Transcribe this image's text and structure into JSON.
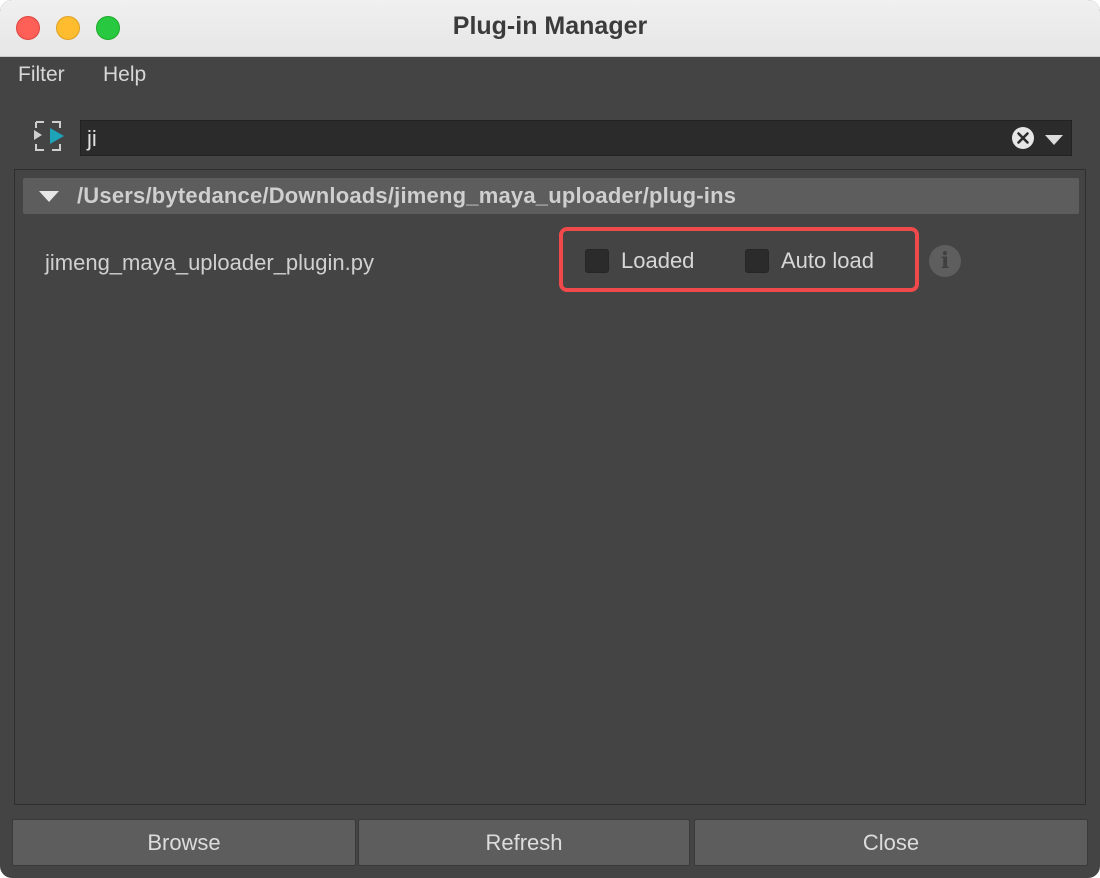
{
  "window": {
    "title": "Plug-in Manager"
  },
  "menu": {
    "items": [
      "Filter",
      "Help"
    ]
  },
  "search": {
    "value": "ji",
    "icons": {
      "filter": "filter-icon",
      "clear": "clear-icon",
      "dropdown": "chevron-down-icon"
    }
  },
  "plugins": {
    "group": {
      "path": "/Users/bytedance/Downloads/jimeng_maya_uploader/plug-ins",
      "expanded": true
    },
    "items": [
      {
        "name": "jimeng_maya_uploader_plugin.py",
        "loaded_label": "Loaded",
        "loaded": false,
        "autoload_label": "Auto load",
        "autoload": false,
        "info_glyph": "i"
      }
    ]
  },
  "footer": {
    "browse_label": "Browse",
    "refresh_label": "Refresh",
    "close_label": "Close"
  },
  "colors": {
    "background": "#444444",
    "highlight": "#f0494b",
    "accent": "#1ea3b8"
  }
}
